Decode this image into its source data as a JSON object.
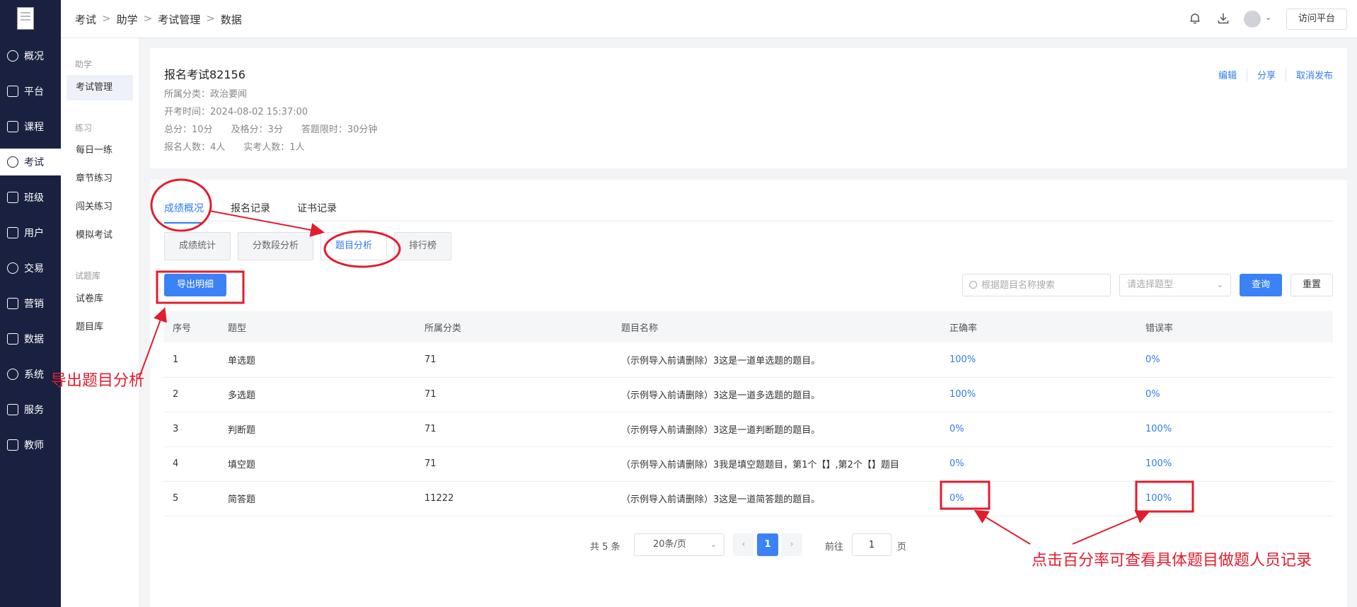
{
  "nav": {
    "items": [
      {
        "label": "概况",
        "icon": "dashboard-icon"
      },
      {
        "label": "平台",
        "icon": "platform-icon"
      },
      {
        "label": "课程",
        "icon": "book-icon"
      },
      {
        "label": "考试",
        "icon": "exam-icon"
      },
      {
        "label": "班级",
        "icon": "class-icon"
      },
      {
        "label": "用户",
        "icon": "user-icon"
      },
      {
        "label": "交易",
        "icon": "trade-icon"
      },
      {
        "label": "营销",
        "icon": "marketing-icon"
      },
      {
        "label": "数据",
        "icon": "chart-icon"
      },
      {
        "label": "系统",
        "icon": "settings-icon"
      },
      {
        "label": "服务",
        "icon": "service-icon"
      },
      {
        "label": "教师",
        "icon": "teacher-icon"
      }
    ],
    "active_label": "考试"
  },
  "submenu": {
    "groups": [
      {
        "title": "助学",
        "items": [
          "考试管理"
        ]
      },
      {
        "title": "练习",
        "items": [
          "每日一练",
          "章节练习",
          "闯关练习",
          "模拟考试"
        ]
      },
      {
        "title": "试题库",
        "items": [
          "试卷库",
          "题目库"
        ]
      }
    ],
    "active_item": "考试管理"
  },
  "breadcrumb": [
    "考试",
    "助学",
    "考试管理",
    "数据"
  ],
  "breadcrumb_sep": ">",
  "header": {
    "visit_label": "访问平台"
  },
  "exam": {
    "title": "报名考试82156",
    "category": "所属分类：政治要闻",
    "start_time": "开考时间：2024-08-02 15:37:00",
    "score_line": "总分：10分　　及格分：3分　　答题限时：30分钟",
    "count_line": "报名人数：4人　　实考人数：1人",
    "actions": [
      "编辑",
      "分享",
      "取消发布"
    ]
  },
  "tabs": [
    "成绩概况",
    "报名记录",
    "证书记录"
  ],
  "active_tab": "成绩概况",
  "subtabs": [
    "成绩统计",
    "分数段分析",
    "题目分析",
    "排行榜"
  ],
  "active_subtab": "题目分析",
  "toolbar": {
    "export_label": "导出明细",
    "search_placeholder": "根据题目名称搜索",
    "type_placeholder": "请选择题型",
    "query_label": "查询",
    "reset_label": "重置"
  },
  "table": {
    "columns": [
      "序号",
      "题型",
      "所属分类",
      "题目名称",
      "正确率",
      "错误率"
    ],
    "rows": [
      [
        "1",
        "单选题",
        "71",
        "（示例导入前请删除）3这是一道单选题的题目。",
        "100%",
        "0%"
      ],
      [
        "2",
        "多选题",
        "71",
        "（示例导入前请删除）3这是一道多选题的题目。",
        "100%",
        "0%"
      ],
      [
        "3",
        "判断题",
        "71",
        "（示例导入前请删除）3这是一道判断题的题目。",
        "0%",
        "100%"
      ],
      [
        "4",
        "填空题",
        "71",
        "（示例导入前请删除）3我是填空题题目，第1个【】,第2个【】题目",
        "0%",
        "100%"
      ],
      [
        "5",
        "简答题",
        "11222",
        "（示例导入前请删除）3这是一道简答题的题目。",
        "0%",
        "100%"
      ]
    ]
  },
  "pagination": {
    "total": "共 5 条",
    "page_size": "20条/页",
    "prev": "‹",
    "current": "1",
    "next": "›",
    "goto_label": "前往",
    "goto_value": "1",
    "page_unit": "页"
  },
  "annotations": {
    "export_note": "导出题目分析",
    "rate_note": "点击百分率可查看具体题目做题人员记录",
    "color": "#e11d2e"
  },
  "colors": {
    "nav_bg": "#1a2140",
    "accent": "#3b82f6",
    "link": "#2f7bf0"
  }
}
